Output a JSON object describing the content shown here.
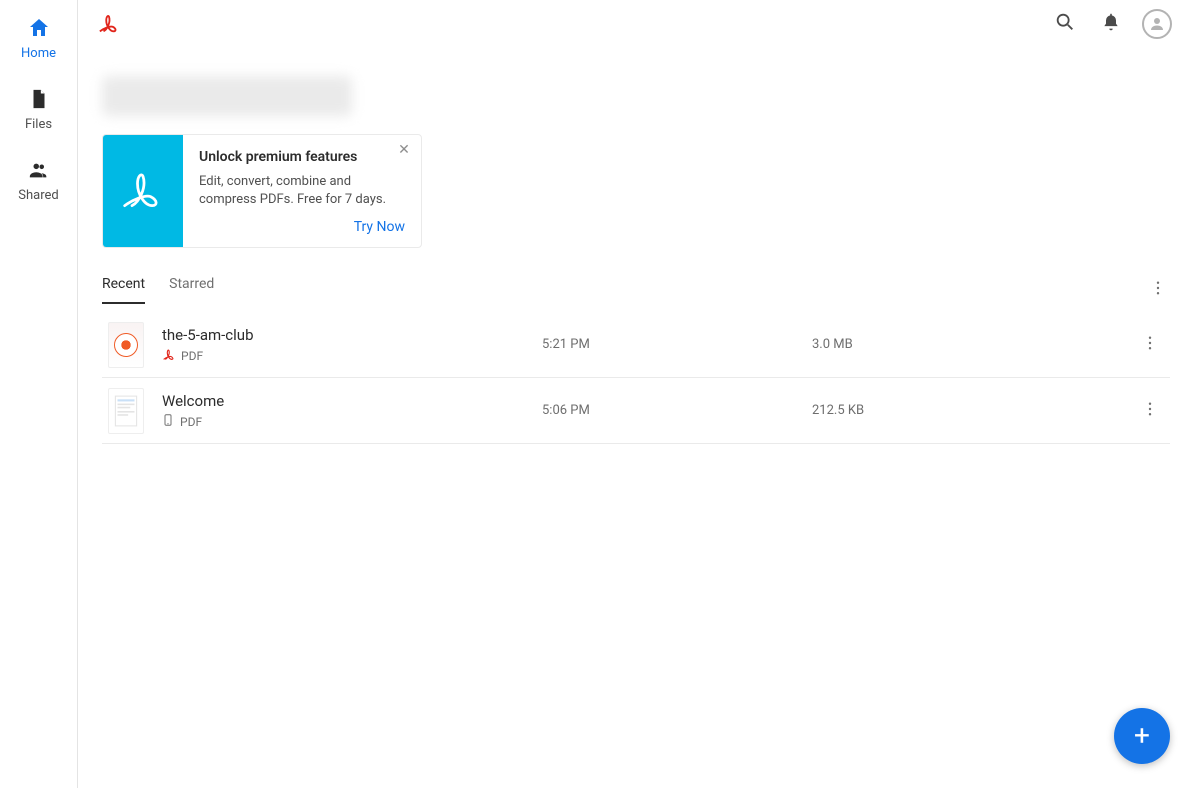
{
  "sidebar": {
    "items": [
      {
        "label": "Home",
        "active": true
      },
      {
        "label": "Files",
        "active": false
      },
      {
        "label": "Shared",
        "active": false
      }
    ]
  },
  "promo": {
    "title": "Unlock premium features",
    "description": "Edit, convert, combine and compress PDFs. Free for 7 days.",
    "action": "Try Now"
  },
  "tabs": {
    "items": [
      {
        "label": "Recent",
        "active": true
      },
      {
        "label": "Starred",
        "active": false
      }
    ]
  },
  "files": [
    {
      "name": "the-5-am-club",
      "type": "PDF",
      "time": "5:21 PM",
      "size": "3.0 MB",
      "icon": "acrobat"
    },
    {
      "name": "Welcome",
      "type": "PDF",
      "time": "5:06 PM",
      "size": "212.5 KB",
      "icon": "device"
    }
  ],
  "colors": {
    "accent": "#1473e6",
    "promo_bg": "#00b9e4",
    "brand_red": "#e1251b"
  }
}
